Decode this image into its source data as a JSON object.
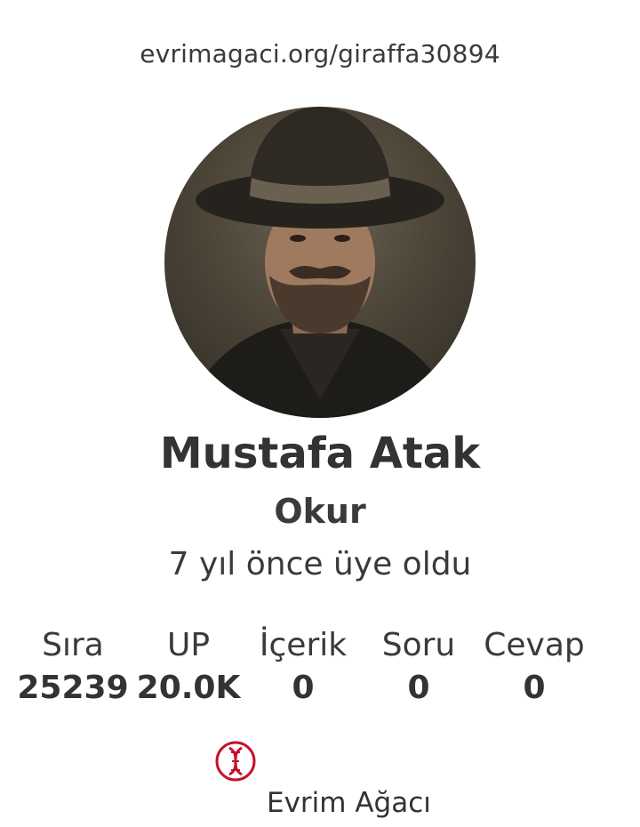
{
  "profile": {
    "url": "evrimagaci.org/giraffa30894",
    "name": "Mustafa Atak",
    "role": "Okur",
    "member_since": "7 yıl önce üye oldu"
  },
  "stats": [
    {
      "label": "Sıra",
      "value": "25239"
    },
    {
      "label": "UP",
      "value": "20.0K"
    },
    {
      "label": "İçerik",
      "value": "0"
    },
    {
      "label": "Soru",
      "value": "0"
    },
    {
      "label": "Cevap",
      "value": "0"
    }
  ],
  "brand": {
    "name": "Evrim Ağacı",
    "logo_icon": "dna-logo-icon",
    "accent_color": "#c8102e"
  }
}
